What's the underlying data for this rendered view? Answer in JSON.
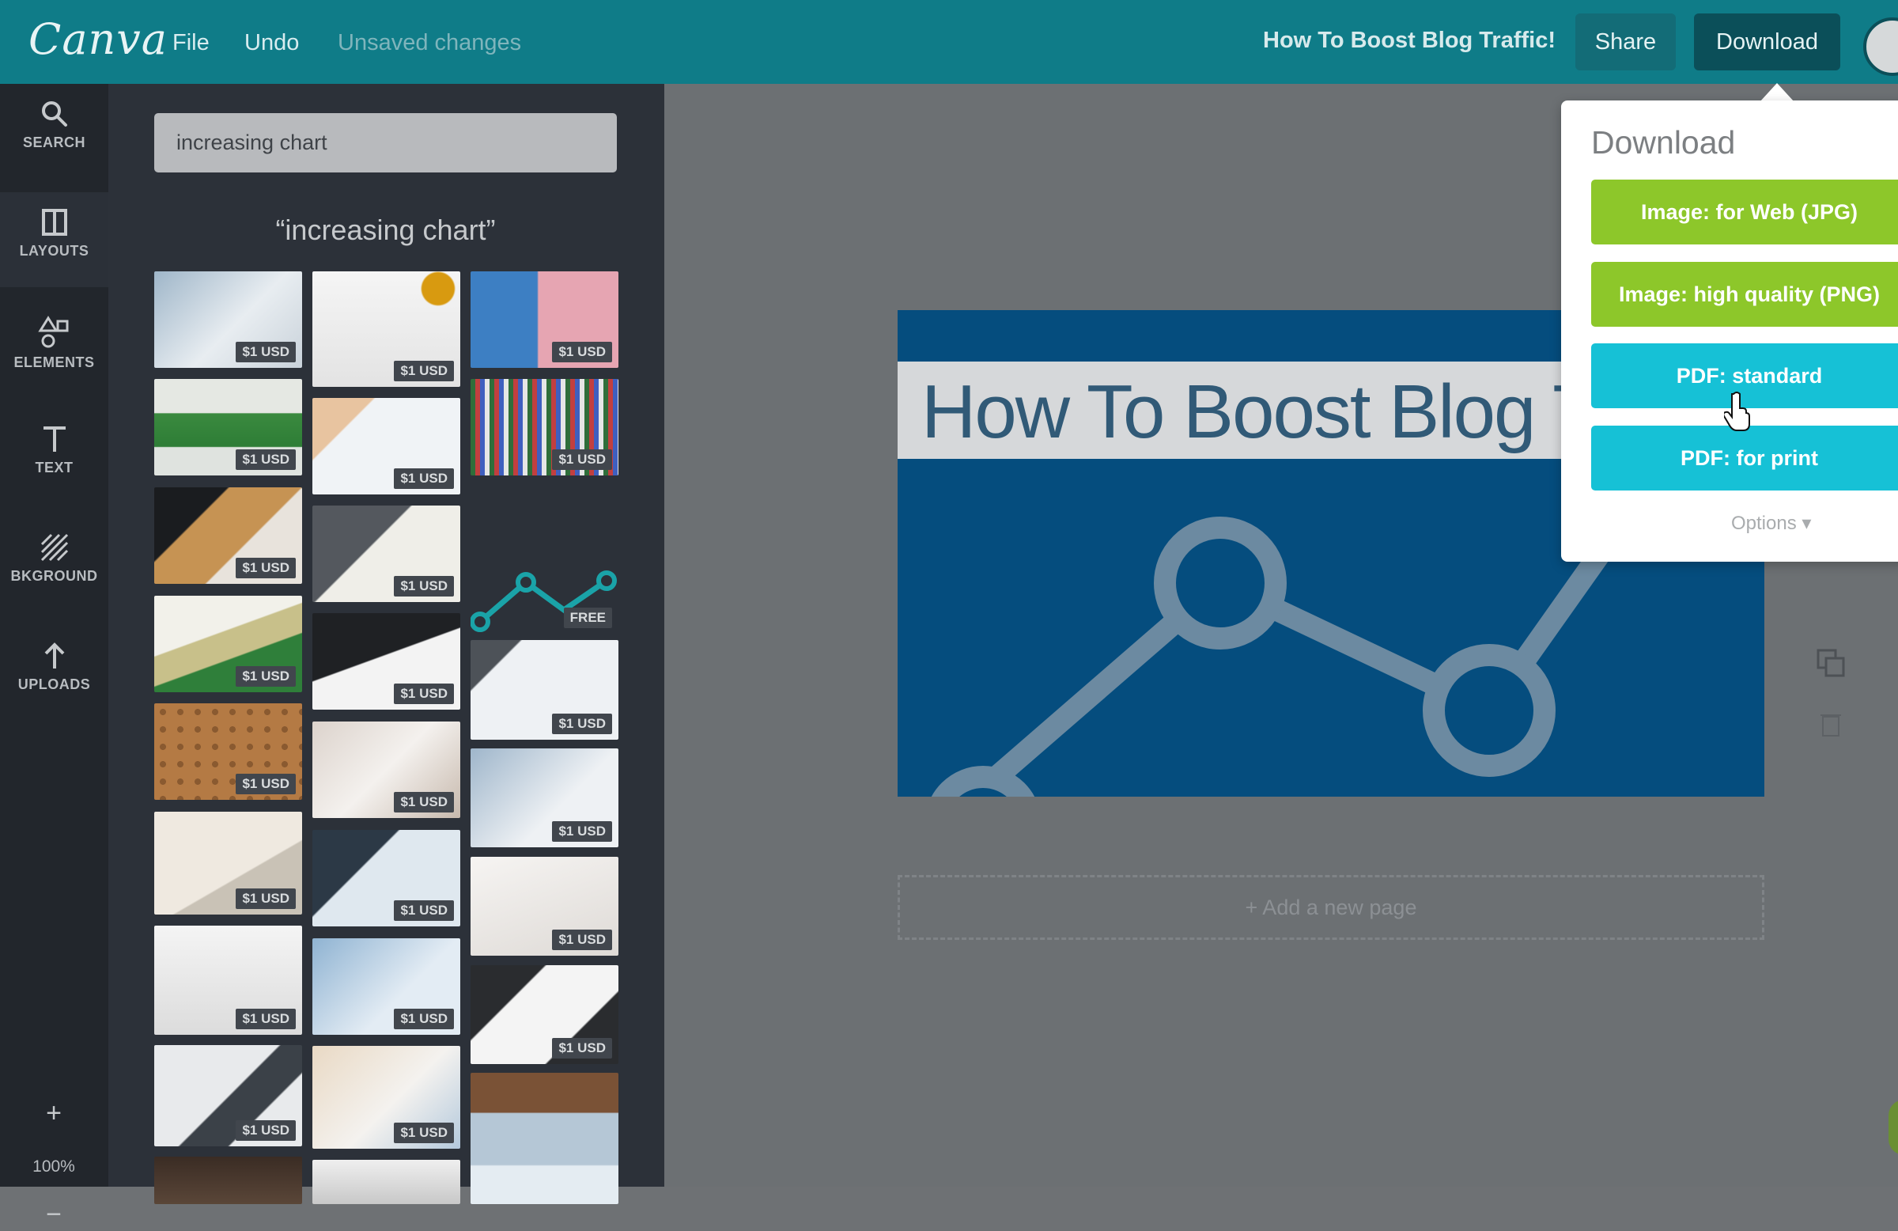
{
  "app": {
    "logo": "Canva"
  },
  "topbar": {
    "menu": {
      "file": "File",
      "undo": "Undo",
      "status": "Unsaved changes"
    },
    "document_title": "How To Boost Blog Traffic!",
    "share_label": "Share",
    "download_label": "Download"
  },
  "rail": {
    "items": [
      {
        "label": "SEARCH",
        "icon": "search-icon"
      },
      {
        "label": "LAYOUTS",
        "icon": "layouts-icon"
      },
      {
        "label": "ELEMENTS",
        "icon": "elements-icon"
      },
      {
        "label": "TEXT",
        "icon": "text-icon"
      },
      {
        "label": "BKGROUND",
        "icon": "background-icon"
      },
      {
        "label": "UPLOADS",
        "icon": "upload-icon"
      }
    ],
    "zoom": {
      "plus": "+",
      "level": "100%",
      "minus": "−"
    }
  },
  "search": {
    "query": "increasing chart",
    "results_heading": "“increasing chart”"
  },
  "results": {
    "col1": [
      "$1 USD",
      "$1 USD",
      "$1 USD",
      "$1 USD",
      "$1 USD",
      "$1 USD",
      "$1 USD",
      "$1 USD"
    ],
    "col2": [
      "$1 USD",
      "$1 USD",
      "$1 USD",
      "$1 USD",
      "$1 USD",
      "$1 USD",
      "$1 USD",
      "$1 USD"
    ],
    "col3": [
      "$1 USD",
      "$1 USD",
      "FREE",
      "$1 USD",
      "$1 USD",
      "$1 USD",
      "$1 USD"
    ]
  },
  "design": {
    "title": "How To Boost Blog Traffic!",
    "add_page": "+ Add a new page"
  },
  "download_popup": {
    "title": "Download",
    "options": [
      "Image: for Web (JPG)",
      "Image: high quality (PNG)",
      "PDF: standard",
      "PDF: for print"
    ],
    "more_options": "Options ▾"
  },
  "colors": {
    "topbar": "#0f7c88",
    "green_button": "#8dc72a",
    "cyan_button": "#16c1d6",
    "design_background": "#054d7e"
  }
}
